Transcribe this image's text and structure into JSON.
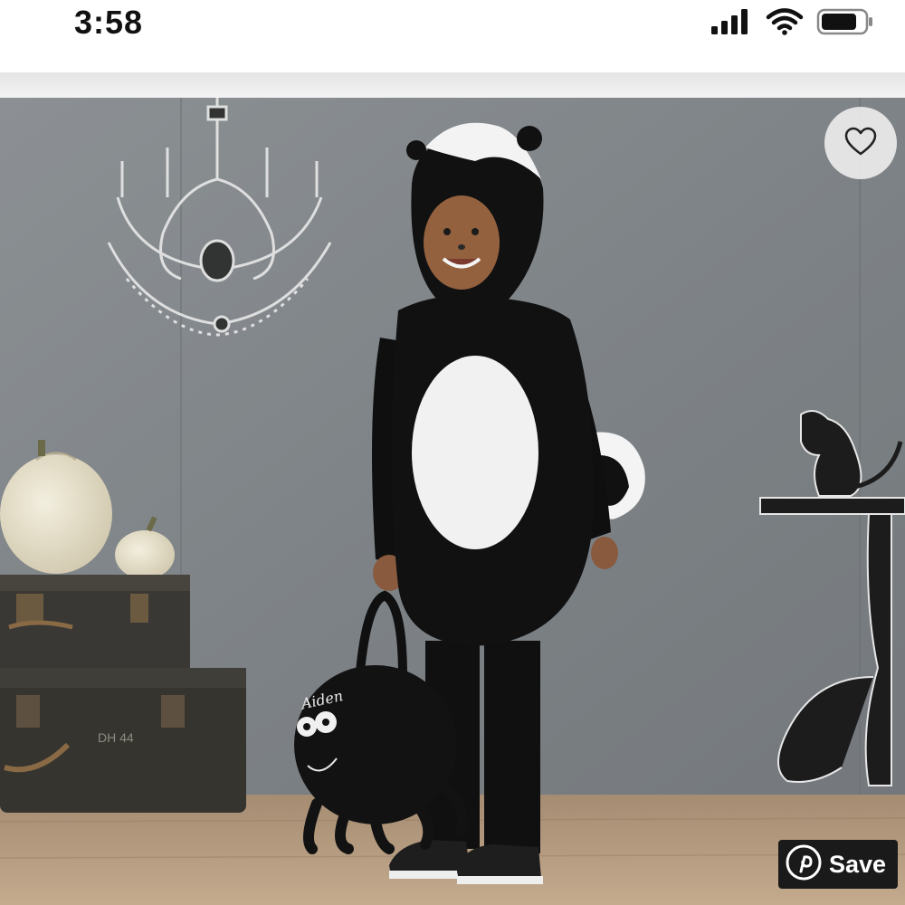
{
  "status_bar": {
    "time": "3:58",
    "icons": [
      "signal-icon",
      "wifi-icon",
      "battery-icon"
    ]
  },
  "photo": {
    "subject": "product-photo",
    "bag_text": "Aiden",
    "suitcase_text": "DH 44"
  },
  "actions": {
    "favorite_icon": "heart-icon",
    "save_label": "Save",
    "save_icon": "pinterest-icon"
  },
  "colors": {
    "wall": "#7f8588",
    "floor": "#b89f82",
    "costume": "#111111",
    "save_bg": "#1a1a1a"
  }
}
